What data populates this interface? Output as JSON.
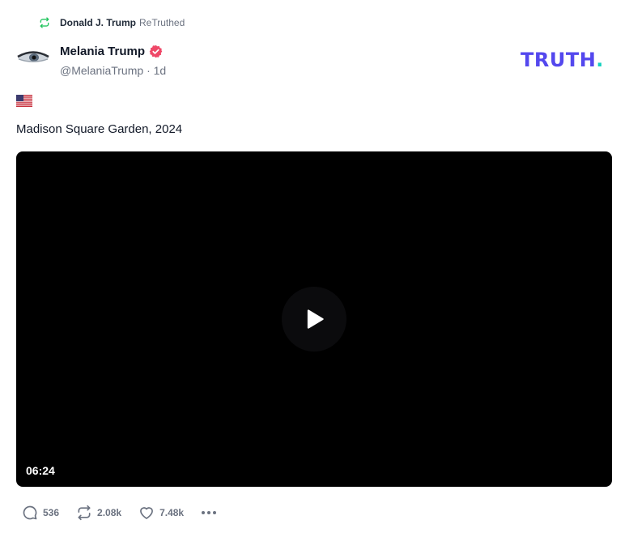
{
  "retruth": {
    "user": "Donald J. Trump",
    "suffix": "ReTruthed",
    "icon": "retruth-icon",
    "color": "#22c55e"
  },
  "author": {
    "name": "Melania Trump",
    "handle": "@MelaniaTrump",
    "time": "1d",
    "verified_color": "#ef4868",
    "avatar_icon": "avatar"
  },
  "brand": {
    "logo_text": "TRUTH",
    "logo_dot": ".",
    "primary_color": "#5448ee",
    "accent_color": "#17d2c0"
  },
  "post": {
    "emoji_icon": "us-flag-icon",
    "text": "Madison Square Garden, 2024"
  },
  "video": {
    "duration": "06:24",
    "play_icon": "play-icon"
  },
  "actions": {
    "replies": "536",
    "retruths": "2.08k",
    "likes": "7.48k",
    "more_icon": "more-icon"
  }
}
